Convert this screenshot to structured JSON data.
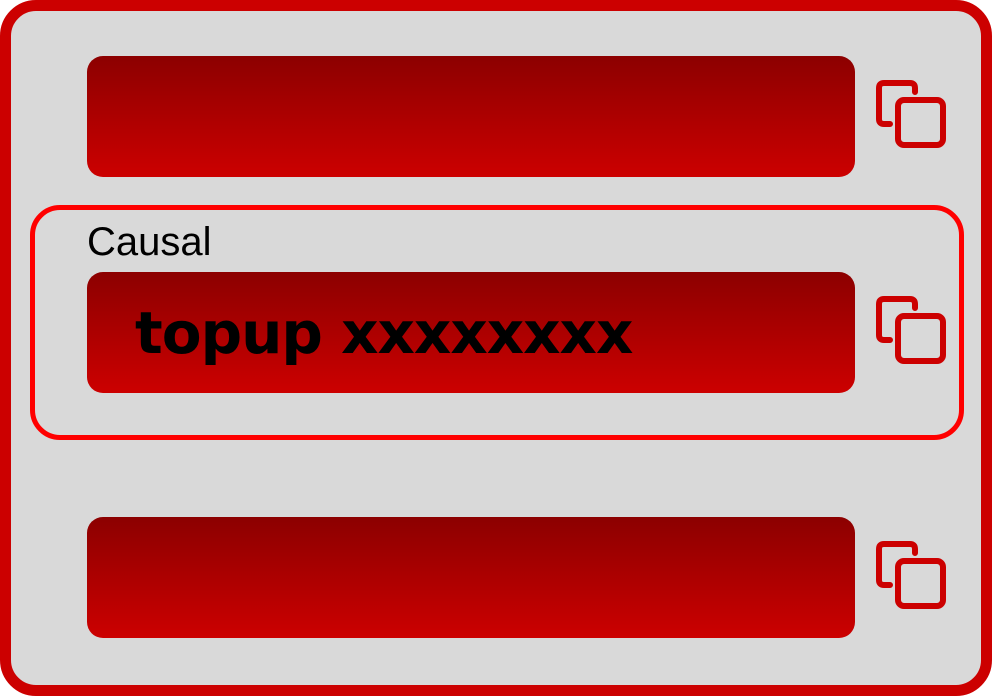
{
  "colors": {
    "frame_border": "#cc0000",
    "background": "#d9d9d9",
    "field_gradient_top": "#8c0000",
    "field_gradient_bottom": "#cc0000",
    "highlight_border": "#ff0000",
    "icon": "#cc0000"
  },
  "fields": [
    {
      "label": "",
      "value": "",
      "copy_icon": "copy-icon"
    },
    {
      "label": "Causal",
      "value": "topup xxxxxxxx",
      "copy_icon": "copy-icon"
    },
    {
      "label": "",
      "value": "",
      "copy_icon": "copy-icon"
    }
  ]
}
